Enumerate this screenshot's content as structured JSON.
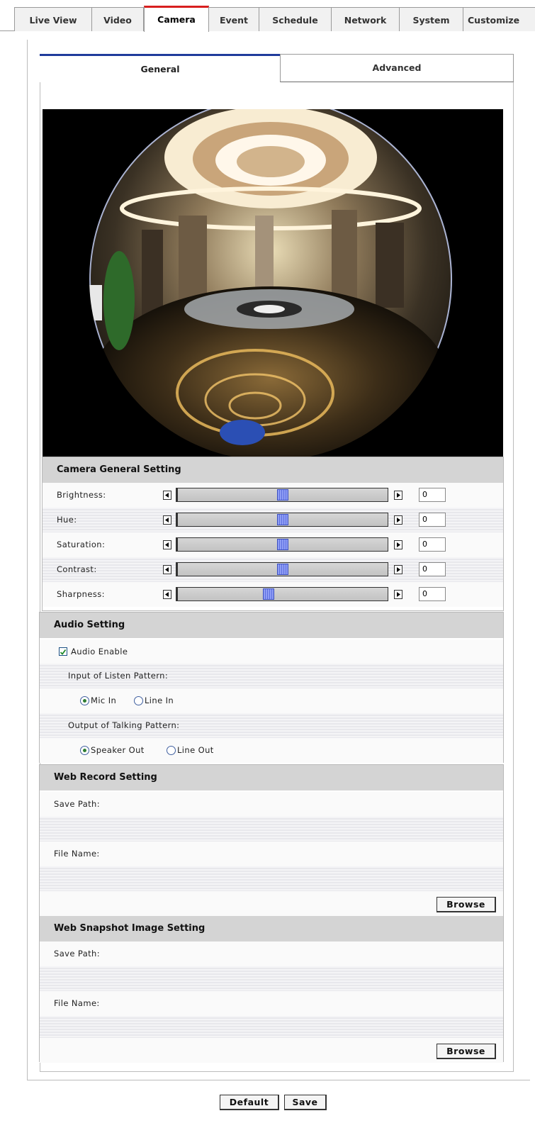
{
  "nav": {
    "tabs": [
      "Live View",
      "Video",
      "Camera",
      "Event",
      "Schedule",
      "Network",
      "System",
      "Customize"
    ],
    "active": "Camera"
  },
  "subtabs": {
    "general": "General",
    "advanced": "Advanced",
    "active": "General"
  },
  "camera_general": {
    "title": "Camera General Setting",
    "sliders": [
      {
        "label": "Brightness:",
        "value": "0",
        "position": 0.5
      },
      {
        "label": "Hue:",
        "value": "0",
        "position": 0.5
      },
      {
        "label": "Saturation:",
        "value": "0",
        "position": 0.5
      },
      {
        "label": "Contrast:",
        "value": "0",
        "position": 0.5
      },
      {
        "label": "Sharpness:",
        "value": "0",
        "position": 0.43
      }
    ]
  },
  "audio": {
    "title": "Audio Setting",
    "enable_label": "Audio Enable",
    "enable_checked": true,
    "input_label": "Input of Listen Pattern:",
    "mic_in": "Mic In",
    "line_in": "Line In",
    "input_selected": "Mic In",
    "output_label": "Output of Talking Pattern:",
    "speaker_out": "Speaker Out",
    "line_out": "Line Out",
    "output_selected": "Speaker Out"
  },
  "web_record": {
    "title": "Web Record Setting",
    "save_path_label": "Save Path:",
    "file_name_label": "File Name:",
    "browse": "Browse"
  },
  "web_snapshot": {
    "title": "Web Snapshot Image Setting",
    "save_path_label": "Save Path:",
    "file_name_label": "File Name:",
    "browse": "Browse"
  },
  "footer": {
    "default": "Default",
    "save": "Save"
  },
  "colors": {
    "active_tab": "#d81f1f",
    "subtab_accent": "#1f3b9b",
    "section_header": "#d4d4d4"
  }
}
